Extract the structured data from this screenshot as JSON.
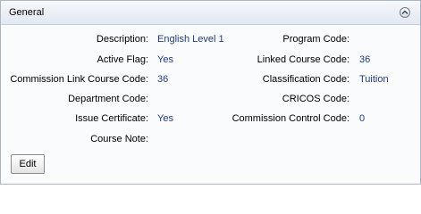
{
  "panel": {
    "title": "General",
    "collapse_icon": "chevron-up-icon"
  },
  "fields": {
    "description": {
      "label": "Description:",
      "value": "English Level 1"
    },
    "program_code": {
      "label": "Program Code:",
      "value": ""
    },
    "active_flag": {
      "label": "Active Flag:",
      "value": "Yes"
    },
    "linked_course_code": {
      "label": "Linked Course Code:",
      "value": "36"
    },
    "commission_link_course_code": {
      "label": "Commission Link Course Code:",
      "value": "36"
    },
    "classification_code": {
      "label": "Classification Code:",
      "value": "Tuition"
    },
    "department_code": {
      "label": "Department Code:",
      "value": ""
    },
    "cricos_code": {
      "label": "CRICOS Code:",
      "value": ""
    },
    "issue_certificate": {
      "label": "Issue Certificate:",
      "value": "Yes"
    },
    "commission_control_code": {
      "label": "Commission Control Code:",
      "value": "0"
    },
    "course_note": {
      "label": "Course Note:",
      "value": ""
    }
  },
  "actions": {
    "edit_label": "Edit"
  },
  "colors": {
    "value_text": "#1f3d78",
    "header_border": "#a9b7c6"
  }
}
